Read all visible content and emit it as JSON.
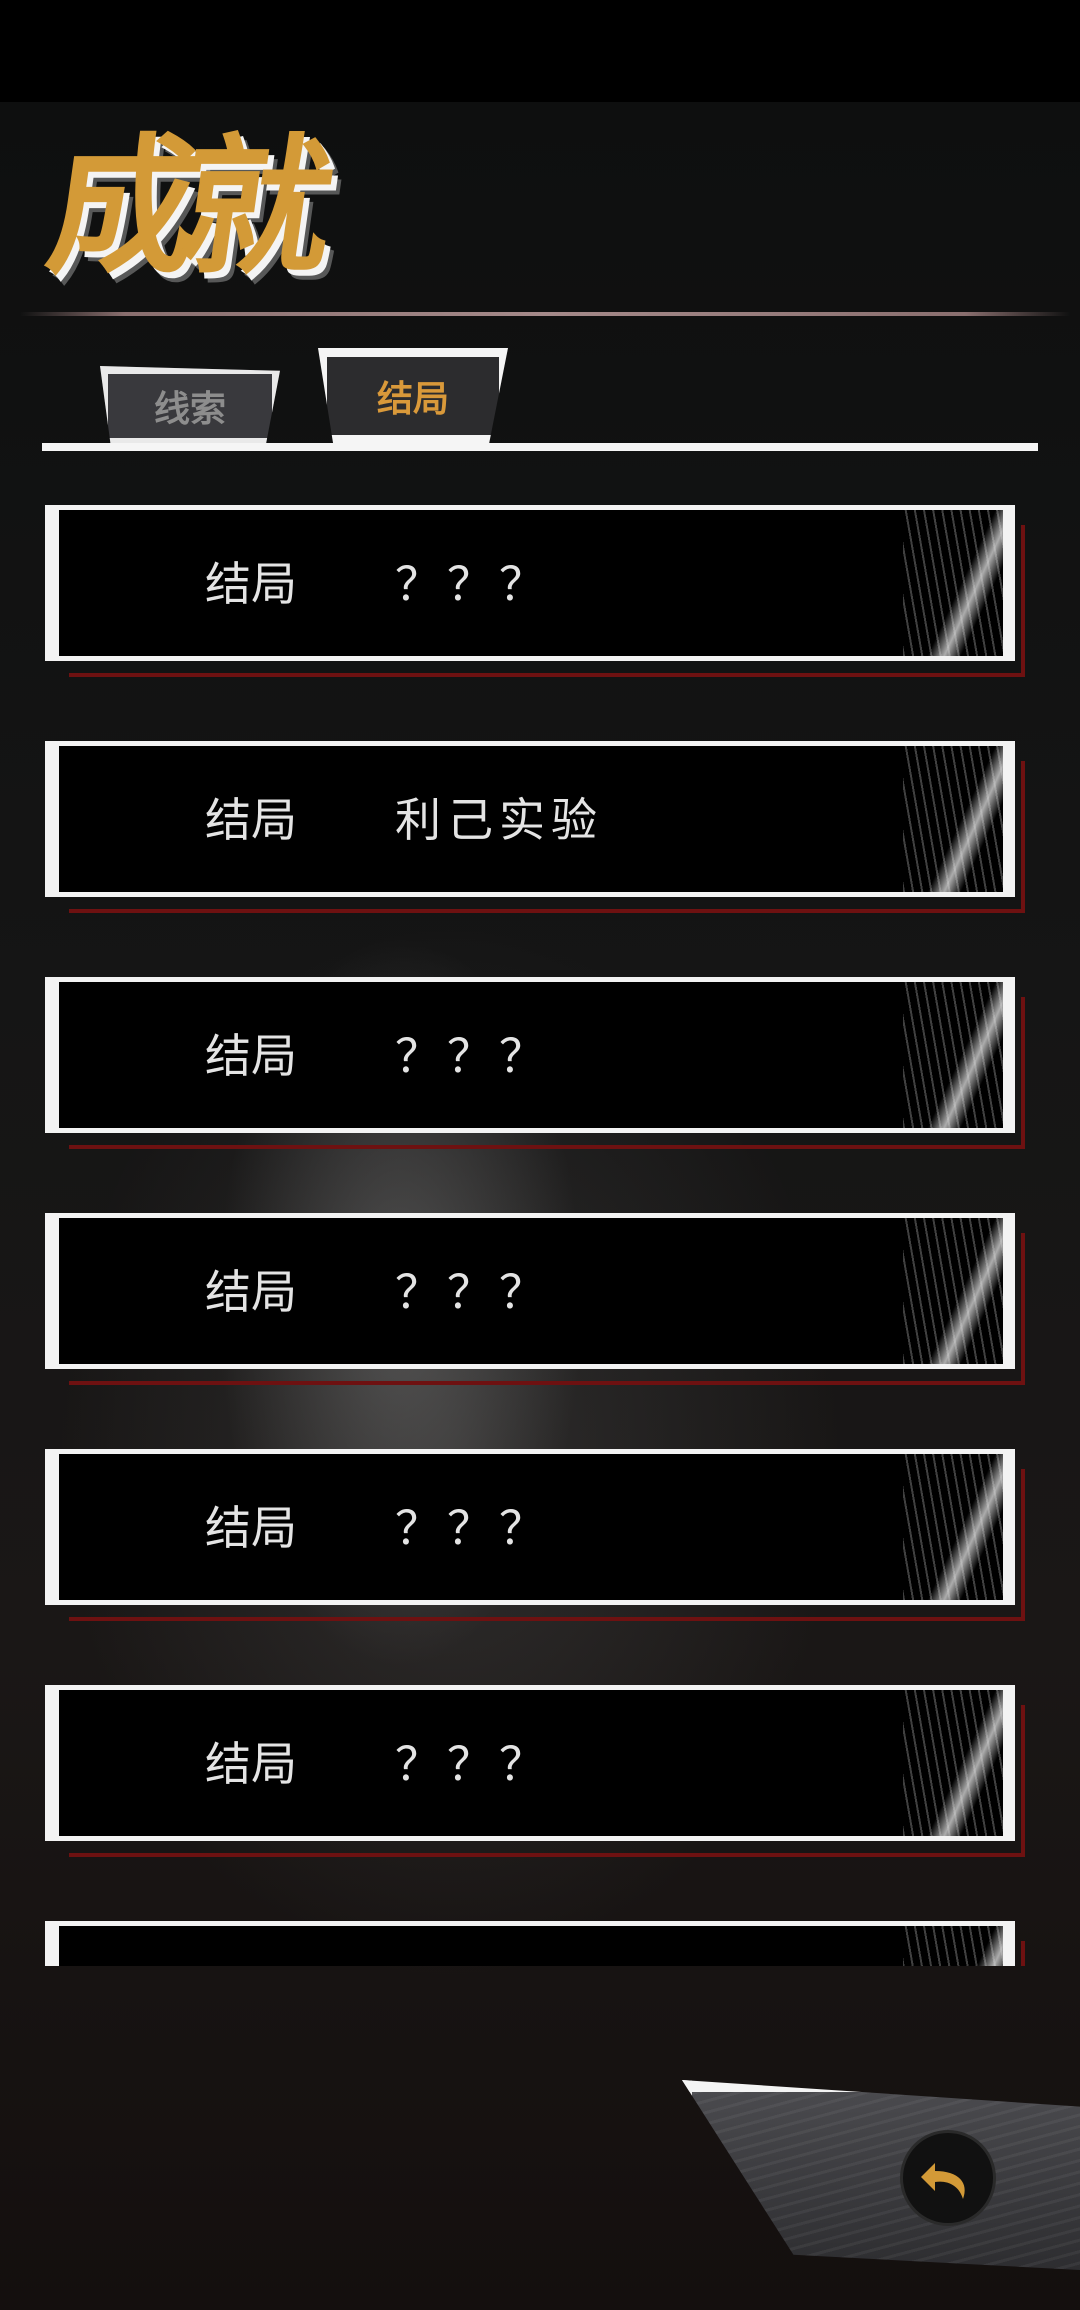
{
  "header": {
    "title": "成就"
  },
  "tabs": [
    {
      "label": "线索",
      "active": false
    },
    {
      "label": "结局",
      "active": true
    }
  ],
  "endings": [
    {
      "label": "结局",
      "name": "？？？",
      "unlocked": false
    },
    {
      "label": "结局",
      "name": "利己实验",
      "unlocked": true
    },
    {
      "label": "结局",
      "name": "？？？",
      "unlocked": false
    },
    {
      "label": "结局",
      "name": "？？？",
      "unlocked": false
    },
    {
      "label": "结局",
      "name": "？？？",
      "unlocked": false
    },
    {
      "label": "结局",
      "name": "？？？",
      "unlocked": false
    }
  ],
  "colors": {
    "accent": "#d39a37",
    "card_border": "#f3f3f3",
    "card_shadow": "#6e1111",
    "inactive_tab_text": "#8d8d8d"
  },
  "icons": {
    "back": "back-arrow-icon"
  }
}
